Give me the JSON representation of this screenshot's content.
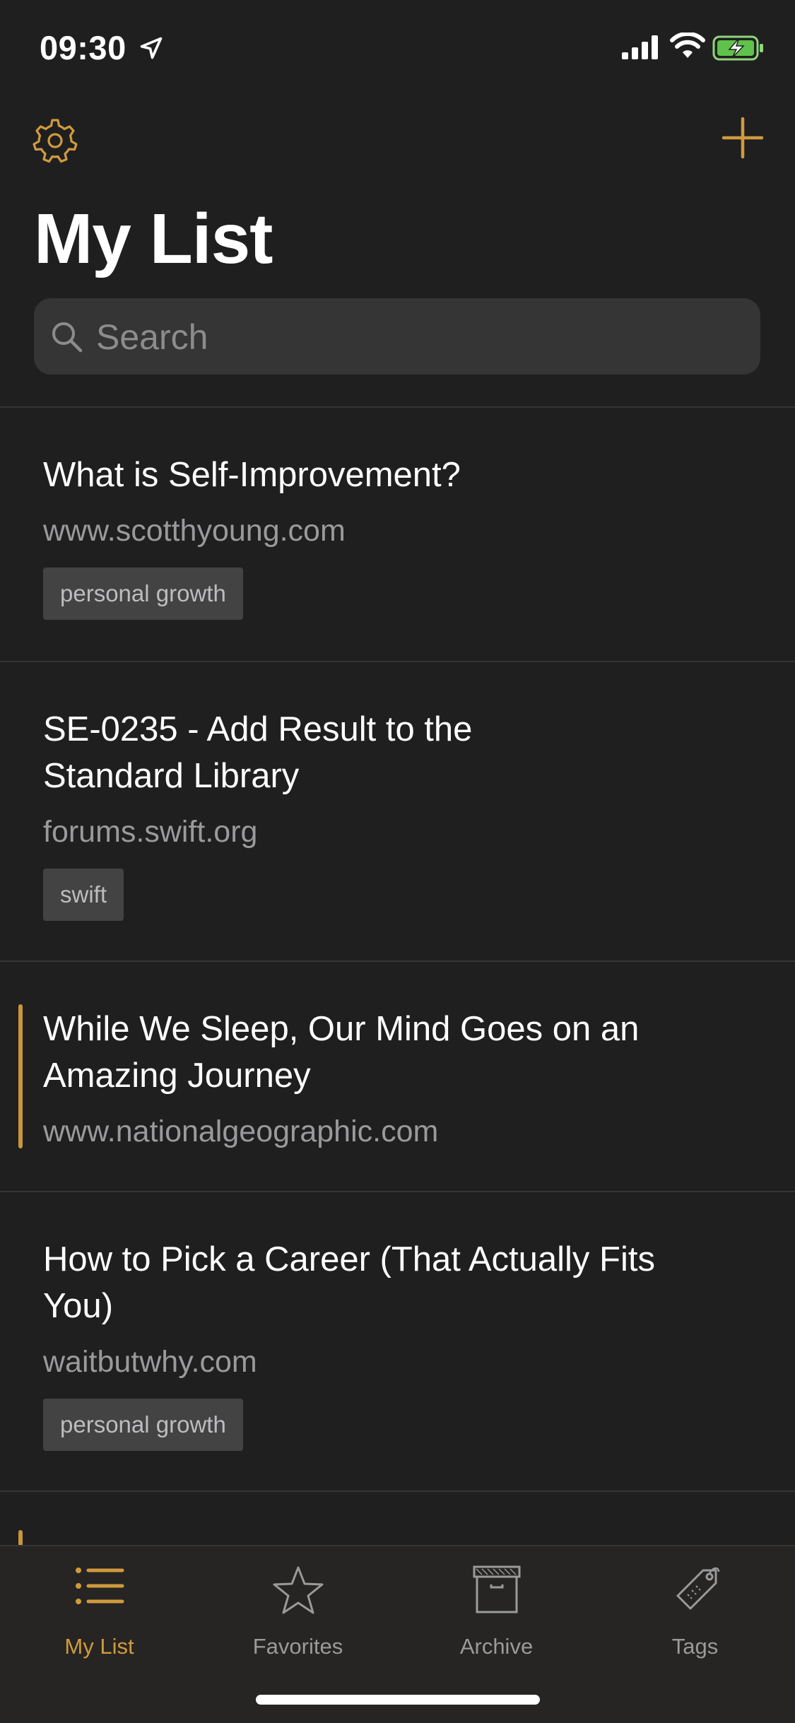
{
  "status": {
    "time": "09:30"
  },
  "header": {
    "title": "My List"
  },
  "search": {
    "placeholder": "Search"
  },
  "items": [
    {
      "title": "What is Self-Improvement?",
      "domain": "www.scotthyoung.com",
      "tag": "personal growth"
    },
    {
      "title": "SE-0235 - Add Result to the Standard Library",
      "domain": "forums.swift.org",
      "tag": "swift"
    },
    {
      "title": "While We Sleep, Our Mind Goes on an Amazing Journey",
      "domain": "www.nationalgeographic.com",
      "tag": ""
    },
    {
      "title": "How to Pick a Career (That Actually Fits You)",
      "domain": "waitbutwhy.com",
      "tag": "personal growth"
    }
  ],
  "tabs": [
    {
      "label": "My List",
      "icon": "list-icon",
      "active": true
    },
    {
      "label": "Favorites",
      "icon": "star-icon",
      "active": false
    },
    {
      "label": "Archive",
      "icon": "archive-box-icon",
      "active": false
    },
    {
      "label": "Tags",
      "icon": "tag-icon",
      "active": false
    }
  ],
  "colors": {
    "accent": "#d09a3d",
    "background": "#1f1f20",
    "search_field": "#353535",
    "tag_background": "#434344"
  }
}
